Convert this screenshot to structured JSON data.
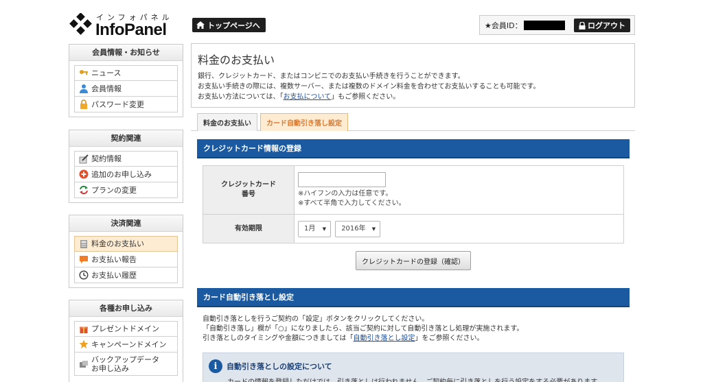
{
  "logo": {
    "kana": "インフォパネル",
    "wordmark": "InfoPanel"
  },
  "header": {
    "top_button": "トップページへ",
    "member_id_label": "★会員ID：",
    "logout_button": "ログアウト"
  },
  "sidebar": {
    "groups": [
      {
        "title": "会員情報・お知らせ",
        "items": [
          "ニュース",
          "会員情報",
          "パスワード変更"
        ]
      },
      {
        "title": "契約関連",
        "items": [
          "契約情報",
          "追加のお申し込み",
          "プランの変更"
        ]
      },
      {
        "title": "決済関連",
        "items": [
          "料金のお支払い",
          "お支払い報告",
          "お支払い履歴"
        ]
      },
      {
        "title": "各種お申し込み",
        "items": [
          "プレゼントドメイン",
          "キャンペーンドメイン",
          "バックアップデータ",
          "お申し込み"
        ]
      }
    ]
  },
  "intro": {
    "title": "料金のお支払い",
    "line1": "銀行、クレジットカード、またはコンビニでのお支払い手続きを行うことができます。",
    "line2": "お支払い手続きの際には、複数サーバー、または複数のドメイン料金を合わせてお支払いすることも可能です。",
    "line3_pre": "お支払い方法については、「",
    "line3_link": "お支払について",
    "line3_post": "」もご参照ください。"
  },
  "tabs": [
    "料金のお支払い",
    "カード自動引き落し設定"
  ],
  "cc_section": {
    "title": "クレジットカード情報の登録",
    "card_label_1": "クレジットカード",
    "card_label_2": "番号",
    "card_input_value": "",
    "note1": "※ハイフンの入力は任意です。",
    "note2": "※すべて半角で入力してください。",
    "expiry_label": "有効期限",
    "month": "1月",
    "year": "2016年",
    "confirm_button": "クレジットカードの登録（確認）"
  },
  "auto_section": {
    "title": "カード自動引き落とし設定",
    "line1": "自動引き落としを行うご契約の「設定」ボタンをクリックしてください。",
    "line2": "「自動引き落し」欄が「○」になりましたら、該当ご契約に対して自動引き落とし処理が実施されます。",
    "line3_pre": "引き落としのタイミングや金額につきましては「",
    "line3_link": "自動引き落とし設定",
    "line3_post": "」をご参照ください。",
    "notice_title": "自動引き落としの設定について",
    "notice_text": "カードの情報を登録しただけでは、引き落としは行われません。ご契約毎に引き落としを行う設定をする必要があります。"
  },
  "colors": {
    "accent_blue": "#1b5aa0",
    "active_tab": "#d9782f",
    "active_bg": "#fdebd2"
  }
}
